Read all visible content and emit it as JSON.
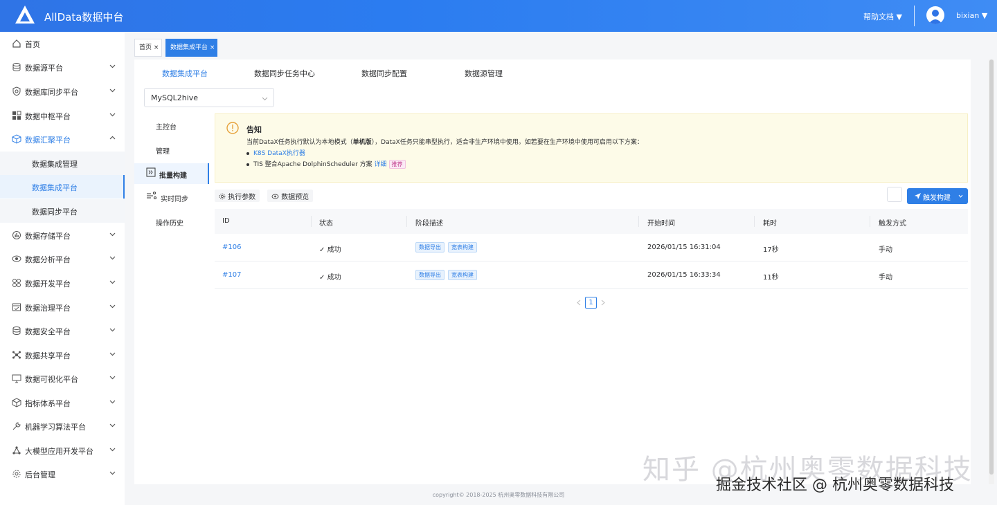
{
  "header": {
    "app_title": "AllData数据中台",
    "help": "帮助文档",
    "help_arrow": "▼",
    "user": "bixian",
    "user_arrow": "▼"
  },
  "sidebar": {
    "items": [
      {
        "label": "首页",
        "icon": "home-icon",
        "expandable": false
      },
      {
        "label": "数据源平台",
        "icon": "database-icon",
        "expandable": true
      },
      {
        "label": "数据库同步平台",
        "icon": "shield-icon",
        "expandable": true
      },
      {
        "label": "数据中枢平台",
        "icon": "grid-icon",
        "expandable": true
      },
      {
        "label": "数据汇聚平台",
        "icon": "cube-icon",
        "expandable": true,
        "expanded": true
      },
      {
        "label": "数据存储平台",
        "icon": "chart-icon",
        "expandable": true
      },
      {
        "label": "数据分析平台",
        "icon": "eye-icon",
        "expandable": true
      },
      {
        "label": "数据开发平台",
        "icon": "apps-icon",
        "expandable": true
      },
      {
        "label": "数据治理平台",
        "icon": "calendar-icon",
        "expandable": true
      },
      {
        "label": "数据安全平台",
        "icon": "database-icon",
        "expandable": true
      },
      {
        "label": "数据共享平台",
        "icon": "share-icon",
        "expandable": true
      },
      {
        "label": "数据可视化平台",
        "icon": "monitor-icon",
        "expandable": true
      },
      {
        "label": "指标体系平台",
        "icon": "cube-icon",
        "expandable": true
      },
      {
        "label": "机器学习算法平台",
        "icon": "tool-icon",
        "expandable": true
      },
      {
        "label": "大模型应用开发平台",
        "icon": "network-icon",
        "expandable": true
      },
      {
        "label": "后台管理",
        "icon": "settings-icon",
        "expandable": true
      }
    ],
    "subitems": [
      "数据集成管理",
      "数据集成平台",
      "数据同步平台"
    ]
  },
  "tags": [
    {
      "label": "首页",
      "close": "×"
    },
    {
      "label": "数据集成平台",
      "close": "×"
    }
  ],
  "top_tabs": [
    "数据集成平台",
    "数据同步任务中心",
    "数据同步配置",
    "数据源管理"
  ],
  "select": {
    "value": "MySQL2hive"
  },
  "left_nav": [
    "主控台",
    "管理",
    "批量构建",
    "实时同步",
    "操作历史"
  ],
  "notice": {
    "title": "告知",
    "body_pre": "当前DataX任务执行默认为本地模式（",
    "body_bold": "单机版",
    "body_post": "），DataX任务只能串型执行，适合非生产环境中使用。如若要在生产环境中使用可启用以下方案：",
    "item1_link": "K8S DataX执行器",
    "item2_text": "TIS 整合Apache DolphinScheduler 方案 ",
    "item2_link": "详细",
    "item2_badge": "推荐"
  },
  "toolbar": {
    "exec_params": "执行参数",
    "data_preview": "数据预览",
    "trigger": "触发构建"
  },
  "table": {
    "columns": [
      "ID",
      "状态",
      "阶段描述",
      "开始时间",
      "耗时",
      "触发方式"
    ],
    "rows": [
      {
        "id": "#106",
        "status": "成功",
        "tags": [
          "数据导出",
          "宽表构建"
        ],
        "start": "2026/01/15 16:31:04",
        "duration": "17秒",
        "trigger": "手动"
      },
      {
        "id": "#107",
        "status": "成功",
        "tags": [
          "数据导出",
          "宽表构建"
        ],
        "start": "2026/01/15 16:33:34",
        "duration": "11秒",
        "trigger": "手动"
      }
    ]
  },
  "pagination": {
    "current": "1"
  },
  "footer": {
    "copyright": "copyright© 2018-2025 杭州奥零数据科技有限公司"
  },
  "watermark": {
    "line1": "知乎 @杭州奥零数据科技",
    "line2": "掘金技术社区 @ 杭州奥零数据科技"
  }
}
